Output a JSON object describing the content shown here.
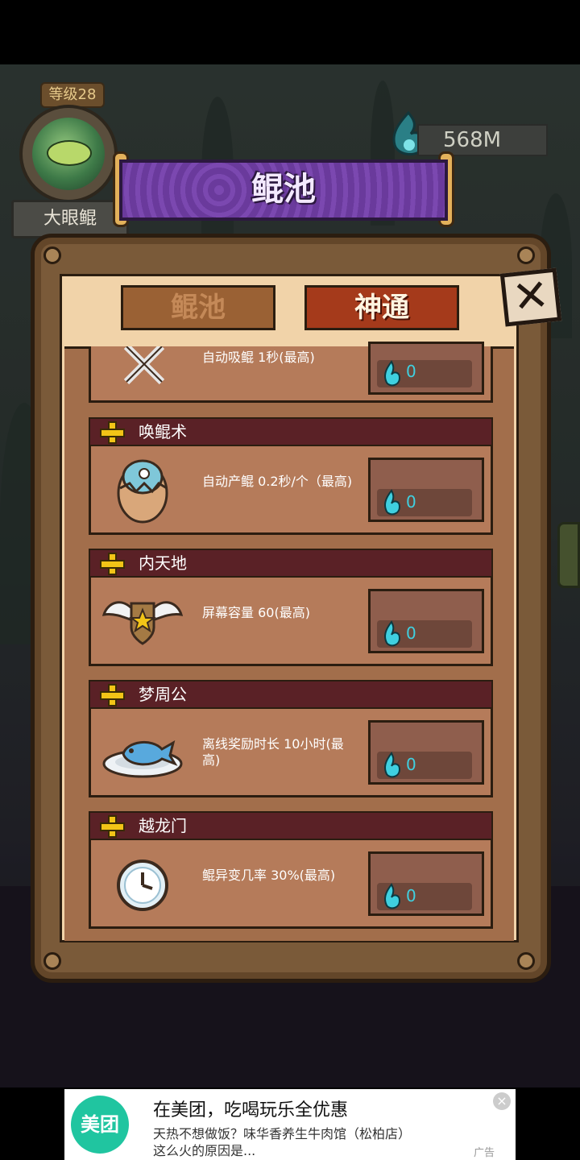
{
  "header": {
    "level": "等级28",
    "fish_name": "大眼鲲",
    "currency": "568M",
    "title": "鲲池"
  },
  "tabs": [
    {
      "label": "鲲池",
      "active": false
    },
    {
      "label": "神通",
      "active": true
    }
  ],
  "skills": [
    {
      "name": "",
      "desc": "自动吸鲲 1秒(最高)",
      "cost": "0",
      "icon": "crossed-blades-icon"
    },
    {
      "name": "唤鲲术",
      "desc": "自动产鲲 0.2秒/个（最高)",
      "cost": "0",
      "icon": "cracked-egg-icon"
    },
    {
      "name": "内天地",
      "desc": "屏幕容量 60(最高)",
      "cost": "0",
      "icon": "winged-shield-icon"
    },
    {
      "name": "梦周公",
      "desc": "离线奖励时长 10小时(最高)",
      "cost": "0",
      "icon": "fish-plate-icon"
    },
    {
      "name": "越龙门",
      "desc": "鲲异变几率 30%(最高)",
      "cost": "0",
      "icon": "clock-icon"
    }
  ],
  "ad": {
    "logo": "美团",
    "title": "在美团，吃喝玩乐全优惠",
    "desc_line1": "天热不想做饭？味华香养生牛肉馆（松柏店）",
    "desc_line2": "这么火的原因是...",
    "tag": "广告",
    "close": "×"
  },
  "colors": {
    "banner": "#6a3a9c",
    "active_tab": "#a53a1b",
    "row_header": "#5a2126",
    "cost_text": "#3fd0e0"
  }
}
